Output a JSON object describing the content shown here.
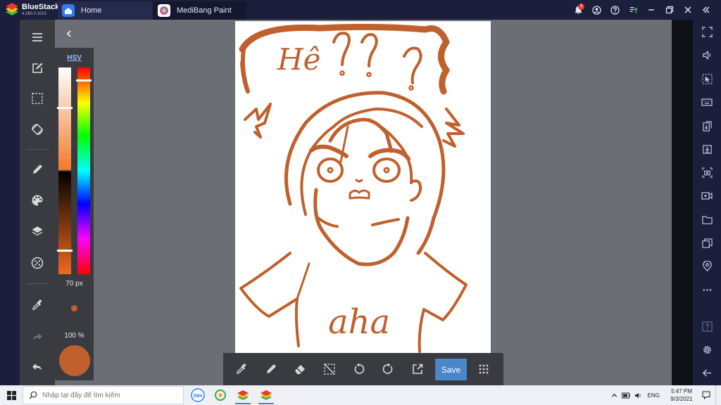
{
  "colors": {
    "brush": "#c0602c",
    "stroke": "#c0602c",
    "accent": "#4a86c8",
    "icon": "#d8d8d8",
    "bluestacks_bg": "#1b1f3b",
    "canvas_area": "#6b6e74",
    "panel": "#3a3b40"
  },
  "titlebar": {
    "brand": "BlueStacks",
    "version": "4.280.0.1022",
    "tabs": [
      {
        "label": "Home",
        "icon": "home-icon"
      },
      {
        "label": "MediBang Paint",
        "icon": "medibang-icon"
      }
    ],
    "notification_count": "3"
  },
  "left_toolbar": {
    "items": [
      "menu-icon",
      "edit-canvas-icon",
      "selection-icon",
      "transform-icon",
      "brush-icon",
      "palette-icon",
      "layers-icon",
      "material-icon",
      "eyedropper-icon",
      "redo-icon",
      "undo-icon"
    ]
  },
  "color_panel": {
    "mode_label": "HSV",
    "brush_size": "70 px",
    "opacity": "100 %",
    "saturation_level": 0.39,
    "brightness_level": 0.77,
    "hue_level": 0.06
  },
  "canvas": {
    "lettering": [
      "Hê",
      "?",
      "?",
      "?",
      "aha"
    ]
  },
  "bottom_bar": {
    "tools": [
      "eyedropper-icon",
      "pen-icon",
      "eraser-icon",
      "deselect-icon",
      "rotate-left-icon",
      "rotate-right-icon",
      "share-icon"
    ],
    "save_label": "Save",
    "grid_icon": "grid-menu-icon"
  },
  "right_sidebar": {
    "items": [
      "fullscreen-icon",
      "volume-icon",
      "pointer-icon",
      "keyboard-icon",
      "install-apk-icon",
      "import-icon",
      "screenshot-icon",
      "record-icon",
      "folder-icon",
      "multi-instance-icon",
      "location-icon",
      "more-icon",
      "help-icon",
      "settings-icon",
      "back-icon"
    ]
  },
  "taskbar": {
    "search_placeholder": "Nhập tại đây để tìm kiếm",
    "apps": [
      "zalo-icon",
      "sync-icon",
      "bluestacks-icon",
      "bluestacks-icon"
    ],
    "zalo_label": "Zalo",
    "language": "ENG",
    "time": "5:47 PM",
    "date": "9/3/2021"
  }
}
